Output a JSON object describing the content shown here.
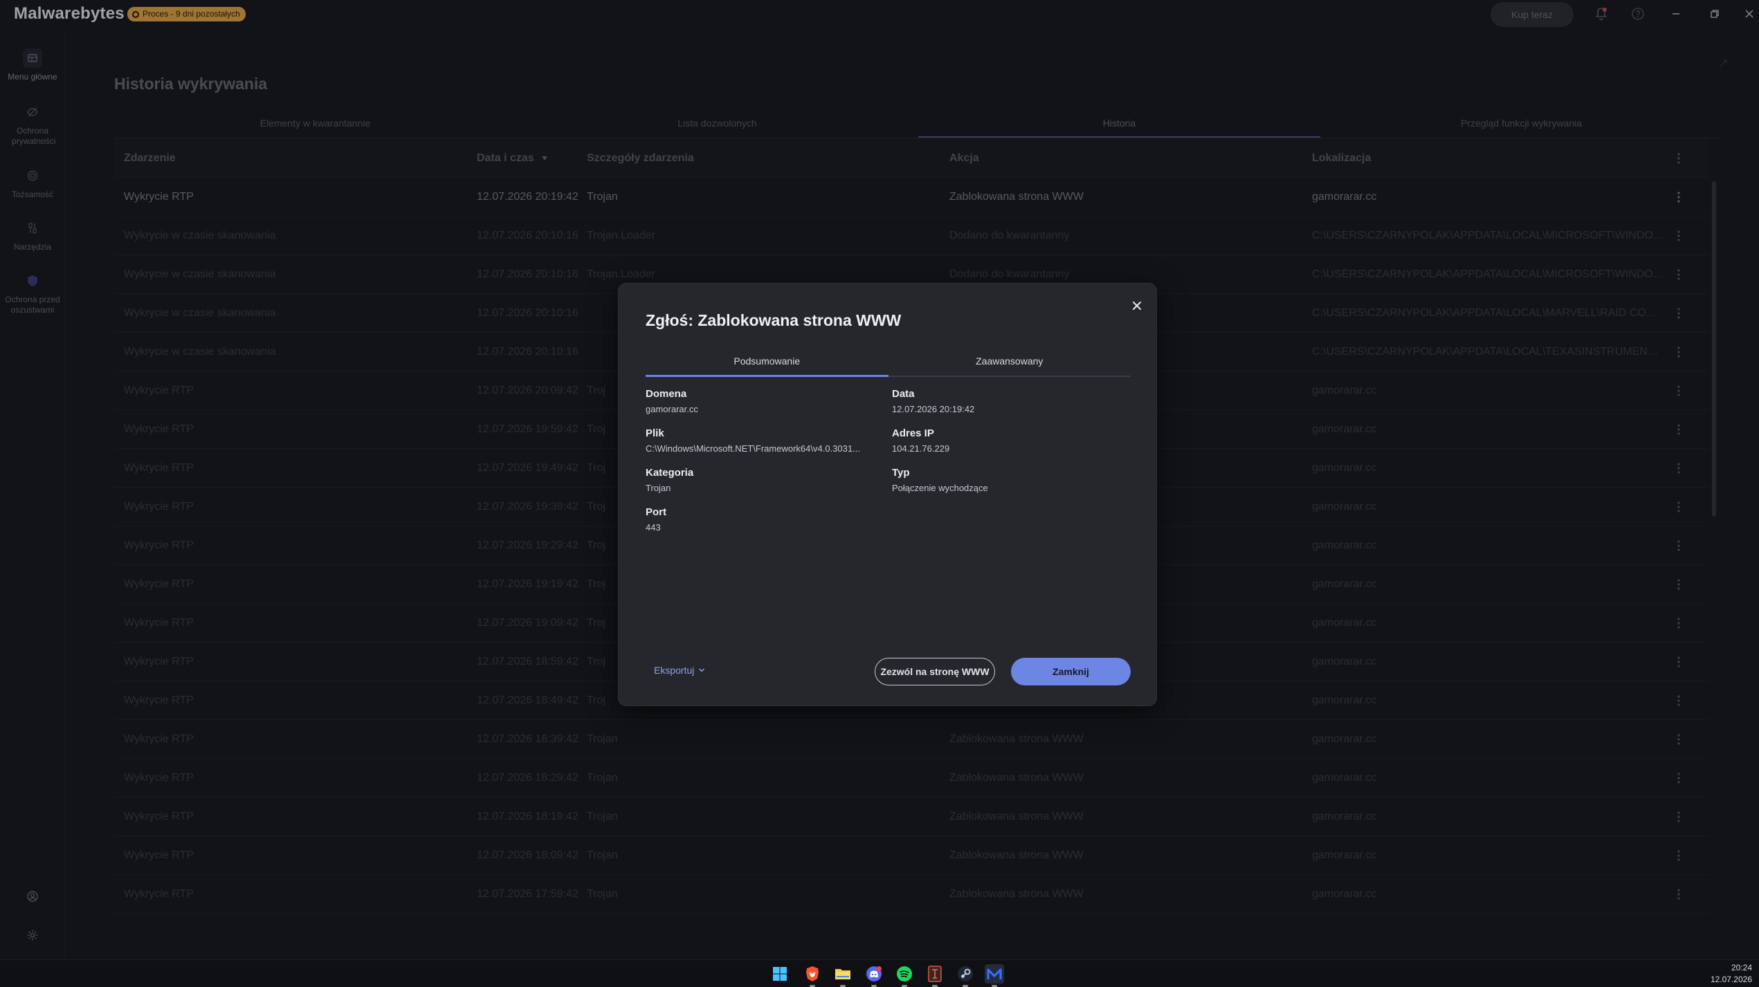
{
  "app": {
    "logo_text": "Malwarebytes",
    "trial_badge": "Proces - 9 dni pozostałych",
    "buy_label": "Kup teraz"
  },
  "sidebar": {
    "items": [
      {
        "label": "Menu główne",
        "icon": "dashboard-icon"
      },
      {
        "label": "Ochrona prywatności",
        "icon": "privacy-eye-icon"
      },
      {
        "label": "Tożsamość",
        "icon": "identity-icon"
      },
      {
        "label": "Narzędzia",
        "icon": "tools-icon"
      },
      {
        "label": "Ochrona przed oszustwami",
        "icon": "scam-shield-icon"
      }
    ]
  },
  "page": {
    "title": "Historia wykrywania",
    "tabs": [
      "Elementy w kwarantannie",
      "Lista dozwolonych",
      "Historia",
      "Przegląd funkcji wykrywania"
    ]
  },
  "table": {
    "columns": [
      "Zdarzenie",
      "Data i czas",
      "Szczegóły zdarzenia",
      "Akcja",
      "Lokalizacja"
    ],
    "rows": [
      [
        "Wykrycie RTP",
        "12.07.2026 20:19:42",
        "Trojan",
        "Zablokowana strona WWW",
        "gamorarar.cc"
      ],
      [
        "Wykrycie w czasie skanowania",
        "12.07.2026 20:10:16",
        "Trojan.Loader",
        "Dodano do kwarantanny",
        "C:\\USERS\\CZARNYPOLAK\\APPDATA\\LOCAL\\MICROSOFT\\WINDOWS\\..."
      ],
      [
        "Wykrycie w czasie skanowania",
        "12.07.2026 20:10:16",
        "Trojan.Loader",
        "Dodano do kwarantanny",
        "C:\\USERS\\CZARNYPOLAK\\APPDATA\\LOCAL\\MICROSOFT\\WINDOWS\\..."
      ],
      [
        "Wykrycie w czasie skanowania",
        "12.07.2026 20:10:16",
        "",
        "",
        "C:\\USERS\\CZARNYPOLAK\\APPDATA\\LOCAL\\MARVELL\\RAID CONFIG\\..."
      ],
      [
        "Wykrycie w czasie skanowania",
        "12.07.2026 20:10:16",
        "",
        "",
        "C:\\USERS\\CZARNYPOLAK\\APPDATA\\LOCAL\\TEXASINSTRUMENTS\\U..."
      ],
      [
        "Wykrycie RTP",
        "12.07.2026 20:09:42",
        "Troj",
        "",
        "gamorarar.cc"
      ],
      [
        "Wykrycie RTP",
        "12.07.2026 19:59:42",
        "Troj",
        "",
        "gamorarar.cc"
      ],
      [
        "Wykrycie RTP",
        "12.07.2026 19:49:42",
        "Troj",
        "",
        "gamorarar.cc"
      ],
      [
        "Wykrycie RTP",
        "12.07.2026 19:39:42",
        "Troj",
        "",
        "gamorarar.cc"
      ],
      [
        "Wykrycie RTP",
        "12.07.2026 19:29:42",
        "Troj",
        "",
        "gamorarar.cc"
      ],
      [
        "Wykrycie RTP",
        "12.07.2026 19:19:42",
        "Troj",
        "",
        "gamorarar.cc"
      ],
      [
        "Wykrycie RTP",
        "12.07.2026 19:09:42",
        "Troj",
        "",
        "gamorarar.cc"
      ],
      [
        "Wykrycie RTP",
        "12.07.2026 18:59:42",
        "Troj",
        "",
        "gamorarar.cc"
      ],
      [
        "Wykrycie RTP",
        "12.07.2026 18:49:42",
        "Troj",
        "",
        "gamorarar.cc"
      ],
      [
        "Wykrycie RTP",
        "12.07.2026 18:39:42",
        "Trojan",
        "Zablokowana strona WWW",
        "gamorarar.cc"
      ],
      [
        "Wykrycie RTP",
        "12.07.2026 18:29:42",
        "Trojan",
        "Zablokowana strona WWW",
        "gamorarar.cc"
      ],
      [
        "Wykrycie RTP",
        "12.07.2026 18:19:42",
        "Trojan",
        "Zablokowana strona WWW",
        "gamorarar.cc"
      ],
      [
        "Wykrycie RTP",
        "12.07.2026 18:09:42",
        "Trojan",
        "Zablokowana strona WWW",
        "gamorarar.cc"
      ],
      [
        "Wykrycie RTP",
        "12.07.2026 17:59:42",
        "Trojan",
        "Zablokowana strona WWW",
        "gamorarar.cc"
      ]
    ]
  },
  "dialog": {
    "title": "Zgłoś: Zablokowana strona WWW",
    "tabs": [
      "Podsumowanie",
      "Zaawansowany"
    ],
    "domain_label": "Domena",
    "domain_value": "gamorarar.cc",
    "date_label": "Data",
    "date_value": "12.07.2026 20:19:42",
    "file_label": "Plik",
    "file_value": "C:\\Windows\\Microsoft.NET\\Framework64\\v4.0.3031...",
    "ip_label": "Adres IP",
    "ip_value": "104.21.76.229",
    "category_label": "Kategoria",
    "category_value": "Trojan",
    "type_label": "Typ",
    "type_value": "Połączenie wychodzące",
    "port_label": "Port",
    "port_value": "443",
    "export_label": "Eksportuj",
    "allow_label": "Zezwól na stronę WWW",
    "close_label": "Zamknij"
  },
  "taskbar": {
    "apps": [
      "windows-start-icon",
      "brave-browser-icon",
      "file-explorer-icon",
      "discord-icon",
      "spotify-icon",
      "git-icon",
      "steam-icon",
      "malwarebytes-icon"
    ],
    "time": "20:24",
    "date": "12.07.2026"
  },
  "colors": {
    "accent": "#6d85e3",
    "badge": "#e2a84a",
    "background": "#1b1c21",
    "dialog": "#26272d"
  }
}
